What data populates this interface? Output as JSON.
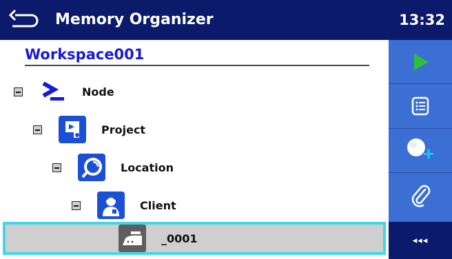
{
  "header": {
    "title": "Memory Organizer",
    "time": "13:32",
    "back_icon": "back-arrow-icon"
  },
  "workspace": {
    "name": "Workspace001"
  },
  "tree": {
    "items": [
      {
        "label": "Node",
        "icon": "node-prompt-icon",
        "expanded": true
      },
      {
        "label": "Project",
        "icon": "project-icon",
        "expanded": true
      },
      {
        "label": "Location",
        "icon": "location-icon",
        "expanded": true
      },
      {
        "label": "Client",
        "icon": "client-icon",
        "expanded": true
      }
    ],
    "selected": {
      "label": "_0001",
      "icon": "appliance-iron-icon"
    }
  },
  "sidebar": {
    "buttons": [
      {
        "icon": "play-icon"
      },
      {
        "icon": "list-icon"
      },
      {
        "icon": "add-icon"
      },
      {
        "icon": "paperclip-icon"
      }
    ],
    "more": {
      "icon": "more-icon",
      "label": "◂◂◂"
    }
  },
  "colors": {
    "header_bg": "#0b1a6b",
    "sidebar_bg": "#3b6fd3",
    "accent_blue": "#1a1ad6",
    "selection_border": "#3fd8e8",
    "play_green": "#2fbf3a",
    "add_cyan": "#22c3e6"
  }
}
